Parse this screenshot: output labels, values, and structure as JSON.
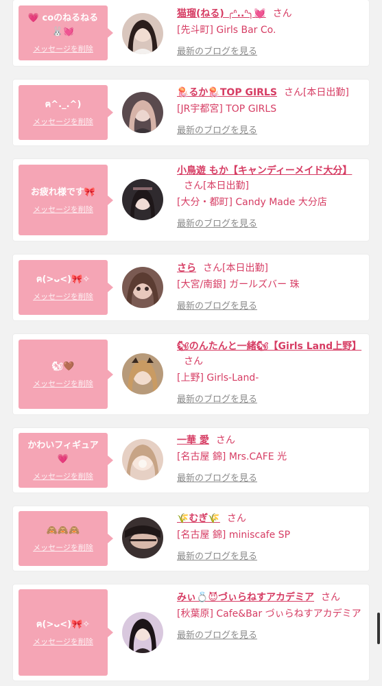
{
  "blog_link_label": "最新のブログを見る",
  "delete_label": "メッセージを削除",
  "colors": {
    "accent": "#d63c63",
    "bubble": "#f5a5b5",
    "background": "#f2f2f2"
  },
  "messages": [
    {
      "message": "💗 coのねるねる🐰💓",
      "name": "猫瑠(ねる) ╭ᐢ..ᐢ╮💓",
      "suffix": "さん",
      "shop": "[先斗町] Girls Bar Co."
    },
    {
      "message": "ฅ^._.^)",
      "name": "🪼るか🪼TOP GIRLS",
      "suffix": "さん[本日出勤]",
      "shop": "[JR宇都宮] TOP GIRLS"
    },
    {
      "message": "お疲れ様です🎀",
      "name": "小鳥遊 もか【キャンディーメイド大分】",
      "suffix": "さん[本日出勤]",
      "shop": "[大分・都町] Candy Made 大分店"
    },
    {
      "message": "ฅ(>ᴗ<)🎀✧",
      "name": "さら",
      "suffix": "さん[本日出勤]",
      "shop": "[大宮/南銀] ガールズバー 珠"
    },
    {
      "message": "🐿🤎",
      "name": "🐿のんたんと一緒🐿【Girls Land上野】",
      "suffix": "さん",
      "shop": "[上野] Girls-Land-"
    },
    {
      "message": "かわいフィギュア💗",
      "name": "一華 愛",
      "suffix": "さん",
      "shop": "[名古屋 錦] Mrs.CAFE 光"
    },
    {
      "message": "🙈🙈🙈",
      "name": "🌾むぎ🌾",
      "suffix": "さん",
      "shop": "[名古屋 錦] miniscafe SP"
    },
    {
      "message": "ฅ(>ᴗ<)🎀✧",
      "name": "みぃ💍😈づぃらねすアカデミア",
      "suffix": "さん",
      "shop": "[秋葉原] Cafe&Bar づぃらねすアカデミア"
    }
  ]
}
